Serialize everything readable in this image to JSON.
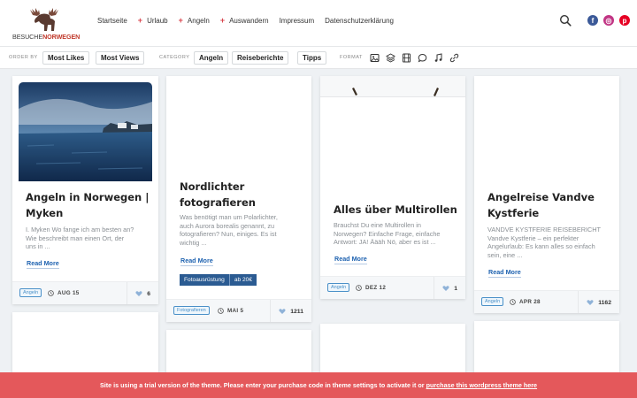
{
  "header": {
    "logo": {
      "part1": "BESUCHE",
      "part2": "NORWEGEN"
    },
    "nav": [
      {
        "label": "Startseite",
        "plus": false
      },
      {
        "label": "Urlaub",
        "plus": true
      },
      {
        "label": "Angeln",
        "plus": true
      },
      {
        "label": "Auswandern",
        "plus": true
      },
      {
        "label": "Impressum",
        "plus": false
      },
      {
        "label": "Datenschutzerklärung",
        "plus": false
      }
    ],
    "plus_symbol": "+",
    "social": [
      {
        "icon": "facebook-icon",
        "glyph": "f",
        "color": "#3b5998"
      },
      {
        "icon": "instagram-icon",
        "glyph": "◎",
        "color": "#c13584"
      },
      {
        "icon": "pinterest-icon",
        "glyph": "p",
        "color": "#e60023"
      }
    ]
  },
  "filters": {
    "order_label": "ORDER BY",
    "order_options": [
      "Most Likes",
      "Most Views"
    ],
    "category_label": "CATEGORY",
    "category_options": [
      "Angeln",
      "Reiseberichte",
      "Tipps"
    ],
    "format_label": "FORMAT",
    "format_icons": [
      "image-icon",
      "layers-icon",
      "film-icon",
      "chat-icon",
      "music-icon",
      "link-icon"
    ]
  },
  "cards": [
    {
      "title_lines": [
        "Angeln in Norwegen |",
        "Myken"
      ],
      "excerpt_lines": [
        "I. Myken Wo fange ich am besten an?",
        "Wie beschreibt man einen Ort, der",
        "uns in ..."
      ],
      "readmore": "Read More",
      "tag": "Angeln",
      "date": "AUG 15",
      "likes": "6"
    },
    {
      "title_lines": [
        "Nordlichter",
        "fotografieren"
      ],
      "excerpt_lines": [
        "Was benötigt man um Polarlichter,",
        "auch Aurora borealis genannt, zu",
        "fotografieren? Nun, einiges. Es ist",
        "wichtig ..."
      ],
      "readmore": "Read More",
      "price_label": "Fotoausrüstung",
      "price_value": "ab 20€",
      "tag": "Fotografieren",
      "date": "MAI 5",
      "likes": "1211"
    },
    {
      "title_lines": [
        "Alles über Multirollen"
      ],
      "excerpt_lines": [
        "Brauchst Du eine Multirollen in",
        "Norwegen? Einfache Frage, einfache",
        "Antwort: JA! Äääh Nö, aber es ist ..."
      ],
      "readmore": "Read More",
      "tag": "Angeln",
      "date": "DEZ 12",
      "likes": "1"
    },
    {
      "title_lines": [
        "Angelreise Vandve",
        "Kystferie"
      ],
      "excerpt_lines": [
        "VANDVE KYSTFERIE REISEBERICHT",
        "Vandve Kystferie – ein perfekter",
        "Angelurlaub: Es kann alles so einfach",
        "sein, eine ..."
      ],
      "readmore": "Read More",
      "tag": "Angeln",
      "date": "APR 28",
      "likes": "1162"
    }
  ],
  "trial": {
    "text": "Site is using a trial version of the theme. Please enter your purchase code in theme settings to activate it or ",
    "link": "purchase this wordpress theme here"
  },
  "colors": {
    "accent_red": "#d9434c",
    "link_blue": "#1e62b0",
    "tag_blue": "#4a90c8",
    "price_bg": "#2b5b92",
    "trial_bg": "#e4585b"
  }
}
